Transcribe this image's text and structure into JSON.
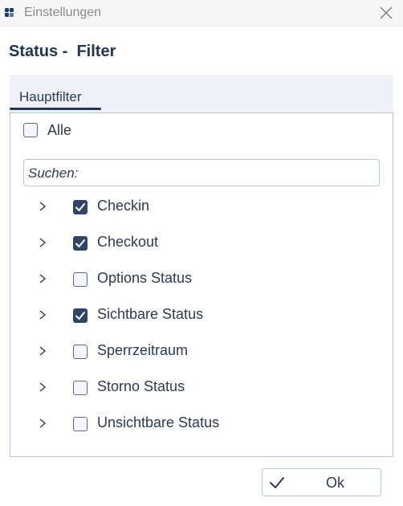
{
  "window": {
    "title": "Einstellungen"
  },
  "heading": "Status -  Filter",
  "tabs": [
    {
      "label": "Hauptfilter",
      "active": true
    }
  ],
  "select_all": {
    "label": "Alle",
    "checked": false
  },
  "search": {
    "placeholder": "Suchen:",
    "value": ""
  },
  "items": [
    {
      "label": "Checkin",
      "checked": true
    },
    {
      "label": "Checkout",
      "checked": true
    },
    {
      "label": "Options Status",
      "checked": false
    },
    {
      "label": "Sichtbare Status",
      "checked": true
    },
    {
      "label": "Sperrzeitraum",
      "checked": false
    },
    {
      "label": "Storno Status",
      "checked": false
    },
    {
      "label": "Unsichtbare Status",
      "checked": false
    }
  ],
  "footer": {
    "ok_label": "Ok"
  },
  "icons": {
    "app": "app-grid-icon",
    "close": "close-icon",
    "expand": "chevron-right-icon",
    "check": "checkmark-icon"
  },
  "colors": {
    "accent": "#2f4466",
    "tab_background": "#eef2f8",
    "border": "#b9c7de"
  }
}
